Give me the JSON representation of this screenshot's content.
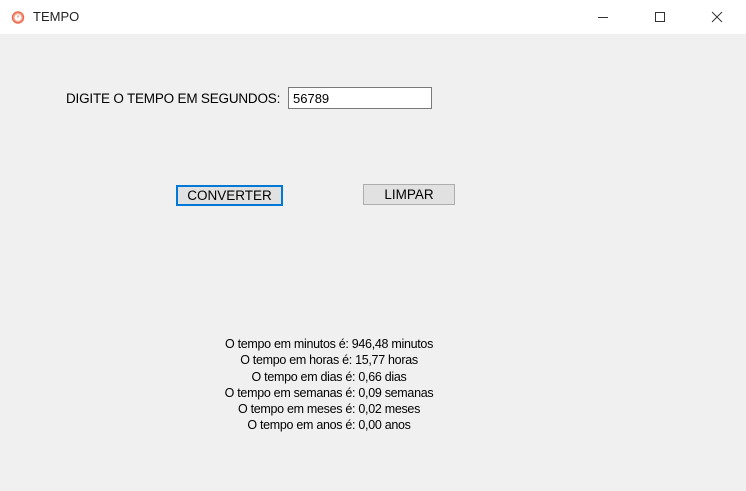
{
  "window": {
    "title": "TEMPO",
    "icons": {
      "app": "stopwatch-icon",
      "minimize": "minimize-icon",
      "maximize": "maximize-icon",
      "close": "close-icon"
    },
    "accent_color": "#0078d7"
  },
  "form": {
    "input_label": "DIGITE O TEMPO EM SEGUNDOS:",
    "input_value": "56789",
    "convert_label": "CONVERTER",
    "clear_label": "LIMPAR"
  },
  "results": [
    "O tempo em minutos é: 946,48 minutos",
    "O tempo em horas é: 15,77 horas",
    "O tempo em dias é: 0,66 dias",
    "O tempo em semanas é: 0,09 semanas",
    "O tempo em meses é: 0,02 meses",
    "O tempo em anos é: 0,00 anos"
  ]
}
